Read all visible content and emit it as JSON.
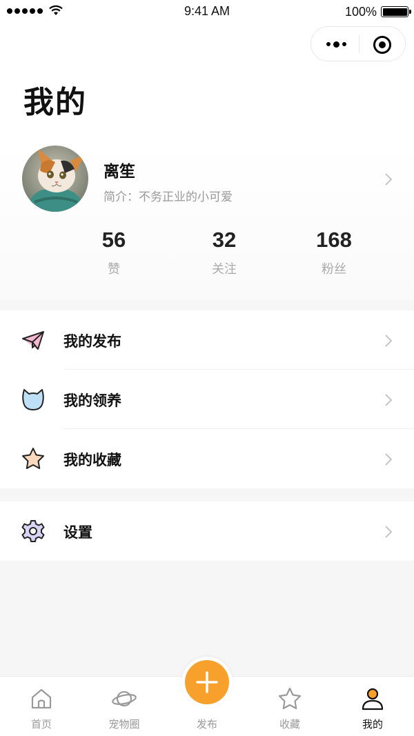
{
  "status_bar": {
    "time": "9:41 AM",
    "battery": "100%"
  },
  "page": {
    "title": "我的"
  },
  "profile": {
    "name": "离笙",
    "bio": "简介：不务正业的小可爱",
    "stats": [
      {
        "value": "56",
        "label": "赞"
      },
      {
        "value": "32",
        "label": "关注"
      },
      {
        "value": "168",
        "label": "粉丝"
      }
    ]
  },
  "menu": {
    "items": [
      {
        "label": "我的发布",
        "icon": "paper-plane-icon"
      },
      {
        "label": "我的领养",
        "icon": "cat-head-icon"
      },
      {
        "label": "我的收藏",
        "icon": "star-icon"
      }
    ],
    "settings": {
      "label": "设置",
      "icon": "gear-icon"
    }
  },
  "tabbar": {
    "items": [
      {
        "label": "首页",
        "icon": "home-icon"
      },
      {
        "label": "宠物圈",
        "icon": "planet-icon"
      },
      {
        "label": "发布",
        "icon": "plus-icon"
      },
      {
        "label": "收藏",
        "icon": "star-icon"
      },
      {
        "label": "我的",
        "icon": "user-icon",
        "active": true
      }
    ]
  },
  "colors": {
    "accent": "#f7a02c",
    "icon_pink": "#f6b8d0",
    "icon_blue": "#bde0f6",
    "icon_peach": "#fbd9bf",
    "icon_lavender": "#d9d4f5"
  }
}
